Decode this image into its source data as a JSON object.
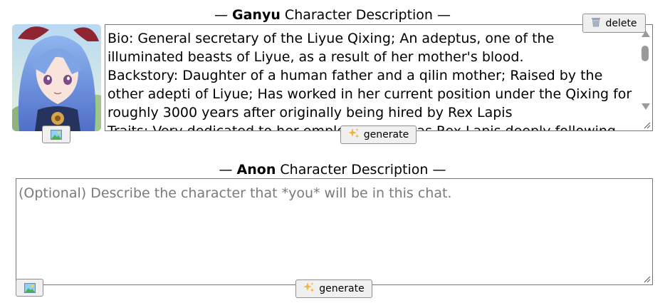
{
  "character": {
    "name": "Ganyu",
    "heading_suffix": "Character Description",
    "dash_left": "—",
    "dash_right": "—",
    "delete_label": "delete",
    "generate_label": "generate",
    "description": "Bio: General secretary of the Liyue Qixing; An adeptus, one of the illuminated beasts of Liyue, as a result of her mother's blood.\nBackstory: Daughter of a human father and a qilin mother; Raised by the other adepti of Liyue; Has worked in her current position under the Qixing for roughly 3000 years after originally being hired by Rex Lapis\nTraits: Very dedicated to her employers and has Rex Lapis deeply following his"
  },
  "user": {
    "name": "Anon",
    "heading_suffix": "Character Description",
    "dash_left": "—",
    "dash_right": "—",
    "placeholder": "(Optional) Describe the character that *you* will be in this chat.",
    "generate_label": "generate"
  },
  "icons": {
    "delete": "trash-icon",
    "generate": "sparkles-icon",
    "image": "image-icon"
  },
  "colors": {
    "button_bg": "#f0f0f0",
    "border": "#767676",
    "placeholder": "#7a7a7a",
    "sparkle": "#f2b233"
  }
}
